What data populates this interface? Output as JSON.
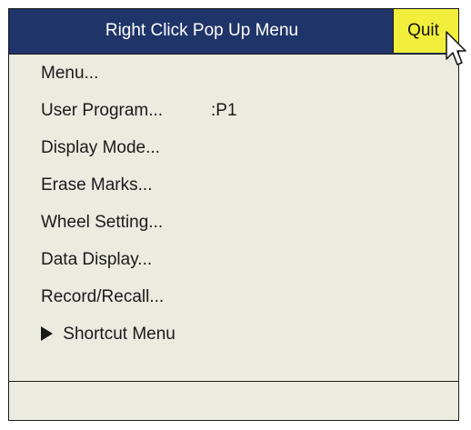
{
  "popup": {
    "title": "Right Click Pop Up Menu",
    "quit_label": "Quit"
  },
  "menu": {
    "items": [
      {
        "label": "Menu..."
      },
      {
        "label": "User Program...",
        "value": ":P1"
      },
      {
        "label": "Display Mode..."
      },
      {
        "label": "Erase Marks..."
      },
      {
        "label": "Wheel Setting..."
      },
      {
        "label": "Data Display..."
      },
      {
        "label": "Record/Recall..."
      },
      {
        "label": "Shortcut Menu",
        "icon": "submenu-arrow-icon"
      }
    ]
  },
  "colors": {
    "title_bar": "#1f3468",
    "quit_button": "#f2ef3c",
    "menu_background": "#ecebe0"
  },
  "icons": {
    "cursor": "mouse-pointer-icon",
    "submenu": "submenu-arrow-icon"
  }
}
